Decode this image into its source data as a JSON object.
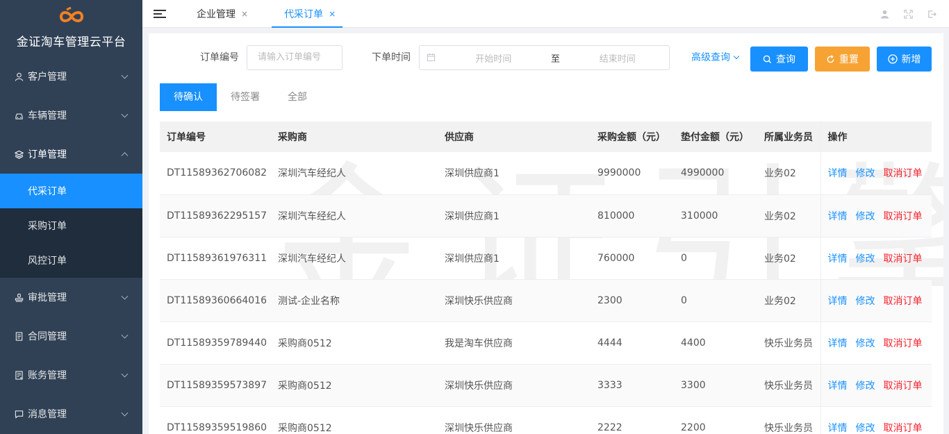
{
  "app": {
    "title": "金证淘车管理云平台"
  },
  "sidebar": {
    "items": [
      {
        "label": "客户管理",
        "icon": "user-icon"
      },
      {
        "label": "车辆管理",
        "icon": "car-icon"
      },
      {
        "label": "订单管理",
        "icon": "layers-icon",
        "expanded": true,
        "children": [
          {
            "label": "代采订单",
            "active": true
          },
          {
            "label": "采购订单"
          },
          {
            "label": "风控订单"
          }
        ]
      },
      {
        "label": "审批管理",
        "icon": "stamp-icon"
      },
      {
        "label": "合同管理",
        "icon": "document-icon"
      },
      {
        "label": "账务管理",
        "icon": "ledger-icon"
      },
      {
        "label": "消息管理",
        "icon": "message-icon"
      }
    ]
  },
  "tabs": [
    {
      "label": "企业管理",
      "close": "×"
    },
    {
      "label": "代采订单",
      "close": "×",
      "active": true
    }
  ],
  "filters": {
    "order_no_label": "订单编号",
    "order_no_placeholder": "请输入订单编号",
    "time_label": "下单时间",
    "start_placeholder": "开始时间",
    "range_separator": "至",
    "end_placeholder": "结束时间",
    "advanced_label": "高级查询",
    "search_button": "查询",
    "reset_button": "重置",
    "add_button": "新增"
  },
  "status_tabs": [
    {
      "label": "待确认",
      "active": true
    },
    {
      "label": "待签署"
    },
    {
      "label": "全部"
    }
  ],
  "table": {
    "columns": [
      "订单编号",
      "采购商",
      "供应商",
      "采购金额（元）",
      "垫付金额（元）",
      "所属业务员",
      "操作"
    ],
    "actions": [
      "详情",
      "修改",
      "取消订单"
    ],
    "rows": [
      [
        "DT11589362706082",
        "深圳汽车经纪人",
        "深圳供应商1",
        "9990000",
        "4990000",
        "业务02"
      ],
      [
        "DT11589362295157",
        "深圳汽车经纪人",
        "深圳供应商1",
        "810000",
        "310000",
        "业务02"
      ],
      [
        "DT11589361976311",
        "深圳汽车经纪人",
        "深圳供应商1",
        "760000",
        "0",
        "业务02"
      ],
      [
        "DT11589360664016",
        "测试-企业名称",
        "深圳快乐供应商",
        "2300",
        "0",
        "业务02"
      ],
      [
        "DT11589359789440",
        "采购商0512",
        "我是淘车供应商",
        "4444",
        "4400",
        "快乐业务员"
      ],
      [
        "DT11589359573897",
        "采购商0512",
        "深圳快乐供应商",
        "3333",
        "3300",
        "快乐业务员"
      ],
      [
        "DT11589359519860",
        "采购商0512",
        "深圳快乐供应商",
        "2222",
        "2200",
        "快乐业务员"
      ]
    ]
  },
  "watermark": "金证引擎",
  "colors": {
    "sidebar": "#304156",
    "submenu": "#1f2d3d",
    "primary": "#1890ff",
    "warning": "#f7a334",
    "danger": "#f5222d"
  }
}
